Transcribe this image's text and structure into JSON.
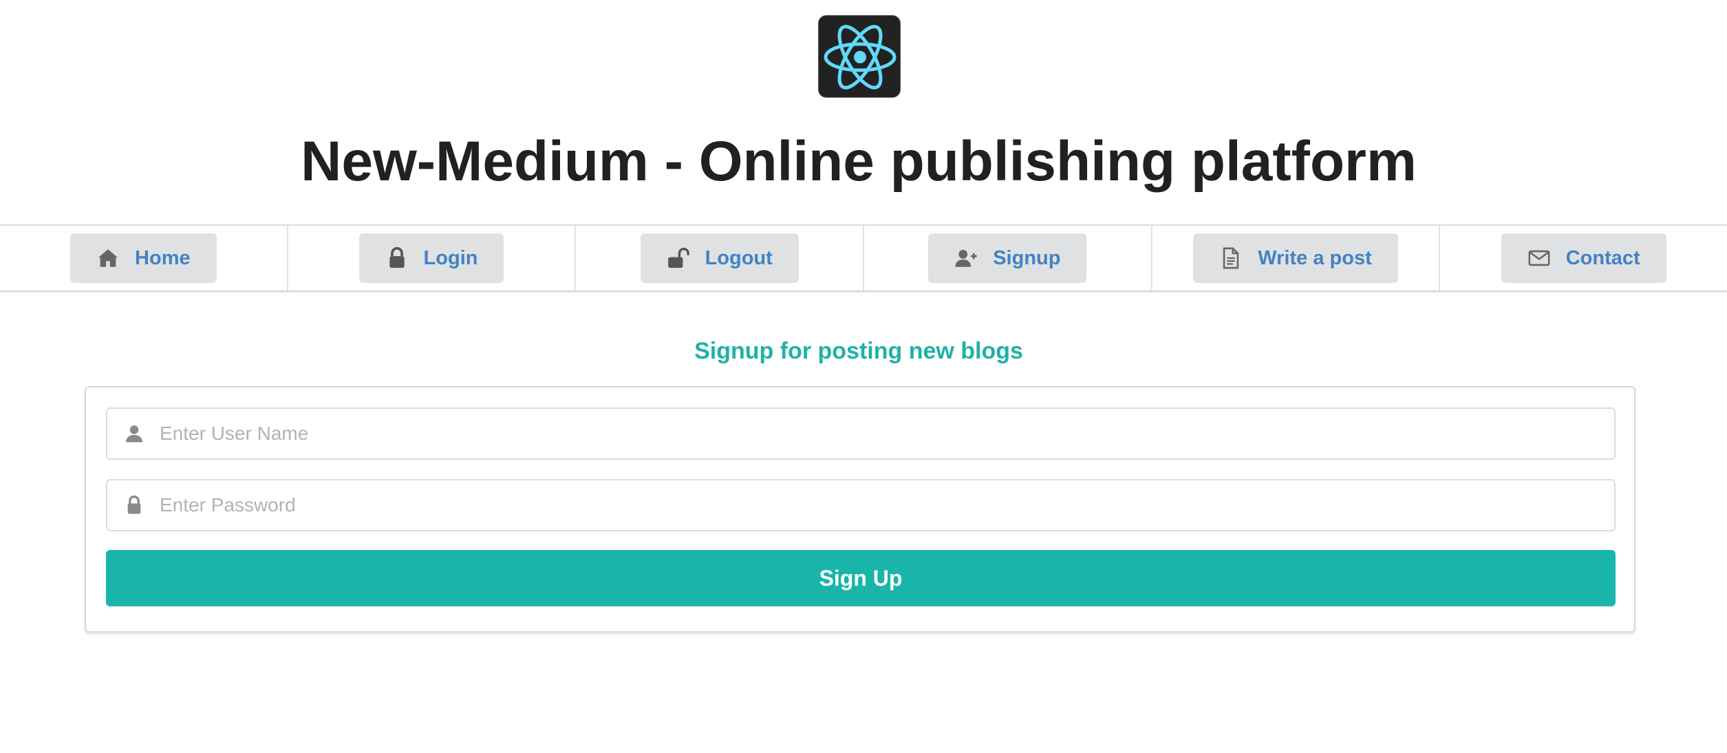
{
  "header": {
    "logo_icon": "react-atom-icon",
    "title": "New-Medium - Online publishing platform"
  },
  "nav": {
    "items": [
      {
        "label": "Home",
        "icon": "home-icon"
      },
      {
        "label": "Login",
        "icon": "lock-icon"
      },
      {
        "label": "Logout",
        "icon": "unlock-icon"
      },
      {
        "label": "Signup",
        "icon": "add-user-icon"
      },
      {
        "label": "Write a post",
        "icon": "file-text-icon"
      },
      {
        "label": "Contact",
        "icon": "envelope-icon"
      }
    ]
  },
  "form": {
    "heading": "Signup for posting new blogs",
    "username_placeholder": "Enter User Name",
    "username_value": "",
    "password_placeholder": "Enter Password",
    "password_value": "",
    "submit_label": "Sign Up"
  },
  "colors": {
    "accent": "#1ab5aa",
    "link": "#4183c4",
    "nav_button_bg": "#e0e1e2",
    "logo_bg": "#222222",
    "logo_atom": "#61dafb"
  }
}
